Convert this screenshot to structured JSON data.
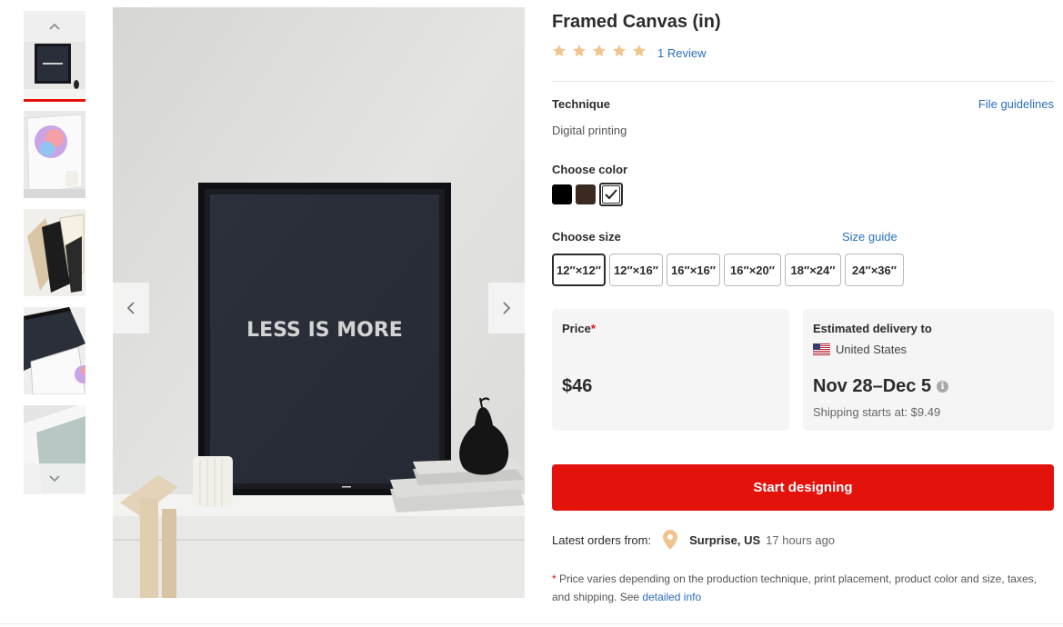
{
  "product": {
    "title": "Framed Canvas (in)",
    "rating": 5,
    "review_label": "1 Review"
  },
  "colors": {
    "accent": "#e3120b",
    "link": "#2a6ebb",
    "star": "#f2c48d"
  },
  "gallery": {
    "thumbnails": [
      "thumbnail-1",
      "thumbnail-2",
      "thumbnail-3",
      "thumbnail-4",
      "thumbnail-5"
    ],
    "active_index": 0,
    "main_image_text": "LESS IS MORE",
    "prev_icon": "chevron-left-icon",
    "next_icon": "chevron-right-icon"
  },
  "technique": {
    "label": "Technique",
    "value": "Digital printing",
    "guidelines_link": "File guidelines"
  },
  "color_picker": {
    "label": "Choose color",
    "options": [
      {
        "name": "black",
        "hex": "#000000"
      },
      {
        "name": "brown",
        "hex": "#3a2a20"
      },
      {
        "name": "white",
        "hex": "#ffffff",
        "selected": true
      }
    ]
  },
  "size_picker": {
    "label": "Choose size",
    "guide_link": "Size guide",
    "options": [
      "12″×12″",
      "12″×16″",
      "16″×16″",
      "16″×20″",
      "18″×24″",
      "24″×36″"
    ],
    "selected": "12″×12″"
  },
  "price": {
    "label": "Price",
    "required_mark": "*",
    "value": "$46"
  },
  "delivery": {
    "label": "Estimated delivery to",
    "country": "United States",
    "range": "Nov 28–Dec 5",
    "shipping": "Shipping starts at: $9.49"
  },
  "cta": {
    "label": "Start designing"
  },
  "latest_orders": {
    "label": "Latest orders from:",
    "location": "Surprise, US",
    "time": "17 hours ago"
  },
  "footnote": {
    "mark": "*",
    "text": " Price varies depending on the production technique, print placement, product color and size, taxes, and shipping. See ",
    "link": "detailed info"
  }
}
